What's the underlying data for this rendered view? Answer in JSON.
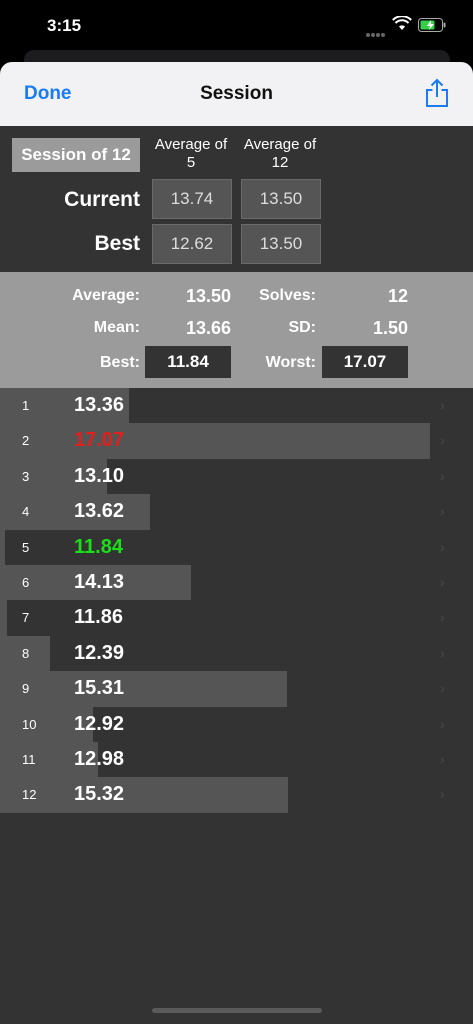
{
  "status_bar": {
    "time": "3:15"
  },
  "nav": {
    "done_label": "Done",
    "title": "Session"
  },
  "stats": {
    "session_label": "Session of 12",
    "col_avg5": "Average of 5",
    "col_avg12": "Average of 12",
    "current_label": "Current",
    "best_label": "Best",
    "current_avg5": "13.74",
    "current_avg12": "13.50",
    "best_avg5": "12.62",
    "best_avg12": "13.50"
  },
  "summary": {
    "average_label": "Average:",
    "average_value": "13.50",
    "solves_label": "Solves:",
    "solves_value": "12",
    "mean_label": "Mean:",
    "mean_value": "13.66",
    "sd_label": "SD:",
    "sd_value": "1.50",
    "best_label": "Best:",
    "best_value": "11.84",
    "worst_label": "Worst:",
    "worst_value": "17.07"
  },
  "solves": [
    {
      "num": "1",
      "time": "13.36",
      "value": 13.36,
      "highlight": "none"
    },
    {
      "num": "2",
      "time": "17.07",
      "value": 17.07,
      "highlight": "worst"
    },
    {
      "num": "3",
      "time": "13.10",
      "value": 13.1,
      "highlight": "none"
    },
    {
      "num": "4",
      "time": "13.62",
      "value": 13.62,
      "highlight": "none"
    },
    {
      "num": "5",
      "time": "11.84",
      "value": 11.84,
      "highlight": "best"
    },
    {
      "num": "6",
      "time": "14.13",
      "value": 14.13,
      "highlight": "none"
    },
    {
      "num": "7",
      "time": "11.86",
      "value": 11.86,
      "highlight": "none"
    },
    {
      "num": "8",
      "time": "12.39",
      "value": 12.39,
      "highlight": "none"
    },
    {
      "num": "9",
      "time": "15.31",
      "value": 15.31,
      "highlight": "none"
    },
    {
      "num": "10",
      "time": "12.92",
      "value": 12.92,
      "highlight": "none"
    },
    {
      "num": "11",
      "time": "12.98",
      "value": 12.98,
      "highlight": "none"
    },
    {
      "num": "12",
      "time": "15.32",
      "value": 15.32,
      "highlight": "none"
    }
  ],
  "colors": {
    "accent": "#1a7cf5",
    "worst": "#e0201c",
    "best": "#1adf1a",
    "bar": "#555555"
  },
  "icons": {
    "share": "share-icon",
    "wifi": "wifi-icon",
    "battery": "battery-charging-icon"
  }
}
